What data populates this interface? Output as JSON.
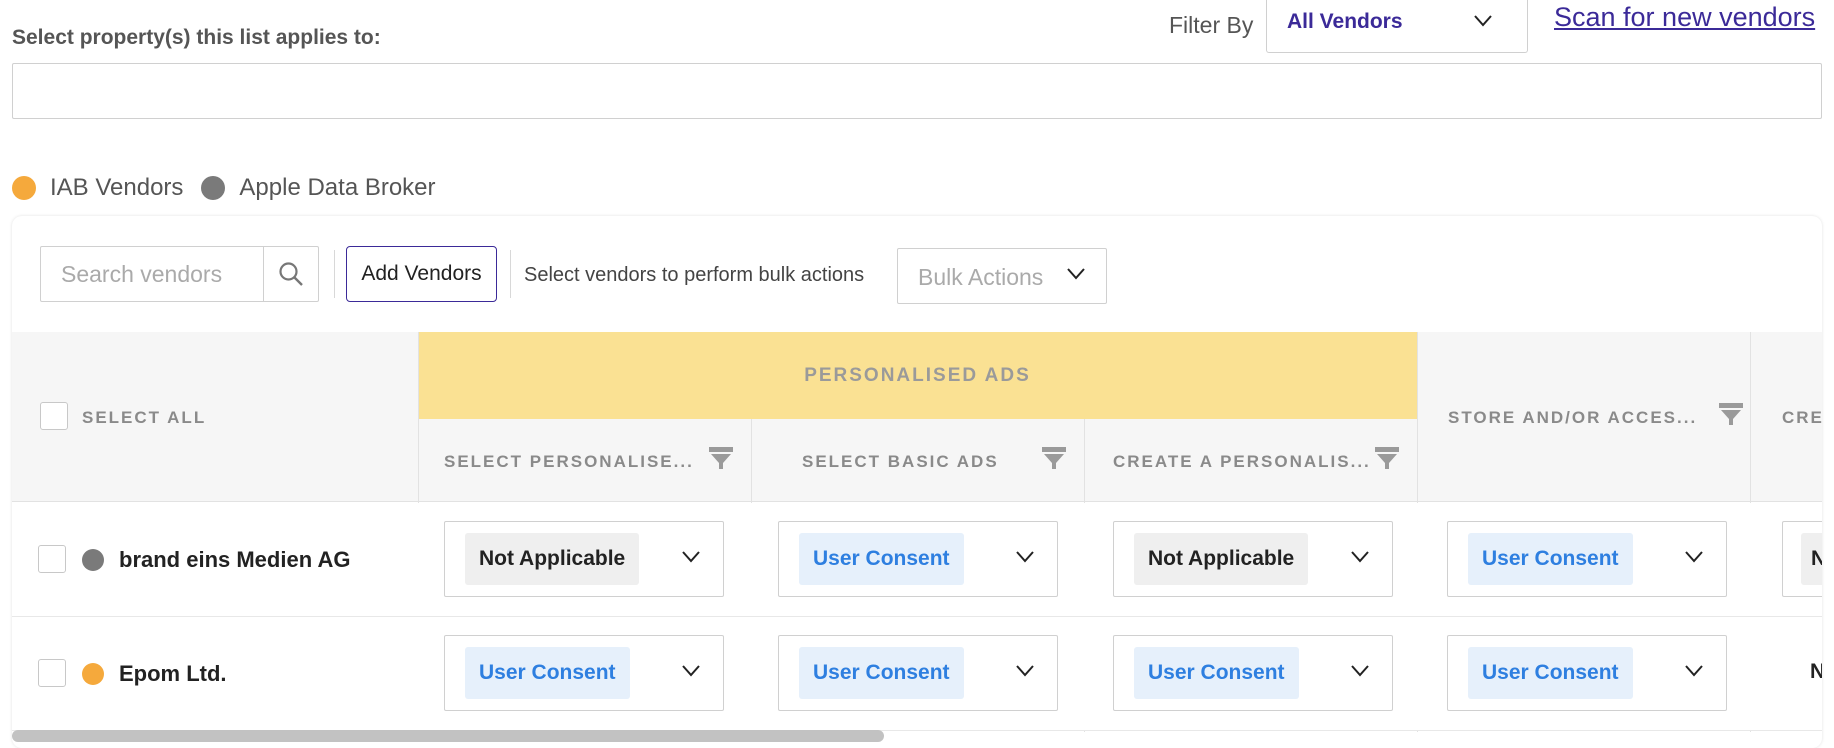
{
  "property": {
    "label": "Select property(s) this list applies to:"
  },
  "filter": {
    "label": "Filter By",
    "value": "All Vendors"
  },
  "scan_link": "Scan for new vendors",
  "legend": [
    {
      "label": "IAB Vendors",
      "color": "#f5a93c"
    },
    {
      "label": "Apple Data Broker",
      "color": "#7a7a7a"
    }
  ],
  "toolbar": {
    "search_placeholder": "Search vendors",
    "add_label": "Add Vendors",
    "bulk_hint": "Select vendors to perform bulk actions",
    "bulk_placeholder": "Bulk Actions"
  },
  "table": {
    "select_all": "SELECT ALL",
    "group_header": "PERSONALISED ADS",
    "columns": [
      "SELECT PERSONALISE...",
      "SELECT BASIC ADS",
      "CREATE A PERSONALIS...",
      "STORE AND/OR ACCES...",
      "CRE"
    ],
    "rows": [
      {
        "name": "brand eins Medien AG",
        "dot_color": "#7a7a7a",
        "values": [
          "Not Applicable",
          "User Consent",
          "Not Applicable",
          "User Consent",
          "N"
        ]
      },
      {
        "name": "Epom Ltd.",
        "dot_color": "#f5a93c",
        "values": [
          "User Consent",
          "User Consent",
          "User Consent",
          "User Consent",
          "N"
        ]
      }
    ]
  },
  "colors": {
    "brand": "#3b2a98",
    "group_header_bg": "#fae193",
    "consent_text": "#2e7fe0"
  }
}
